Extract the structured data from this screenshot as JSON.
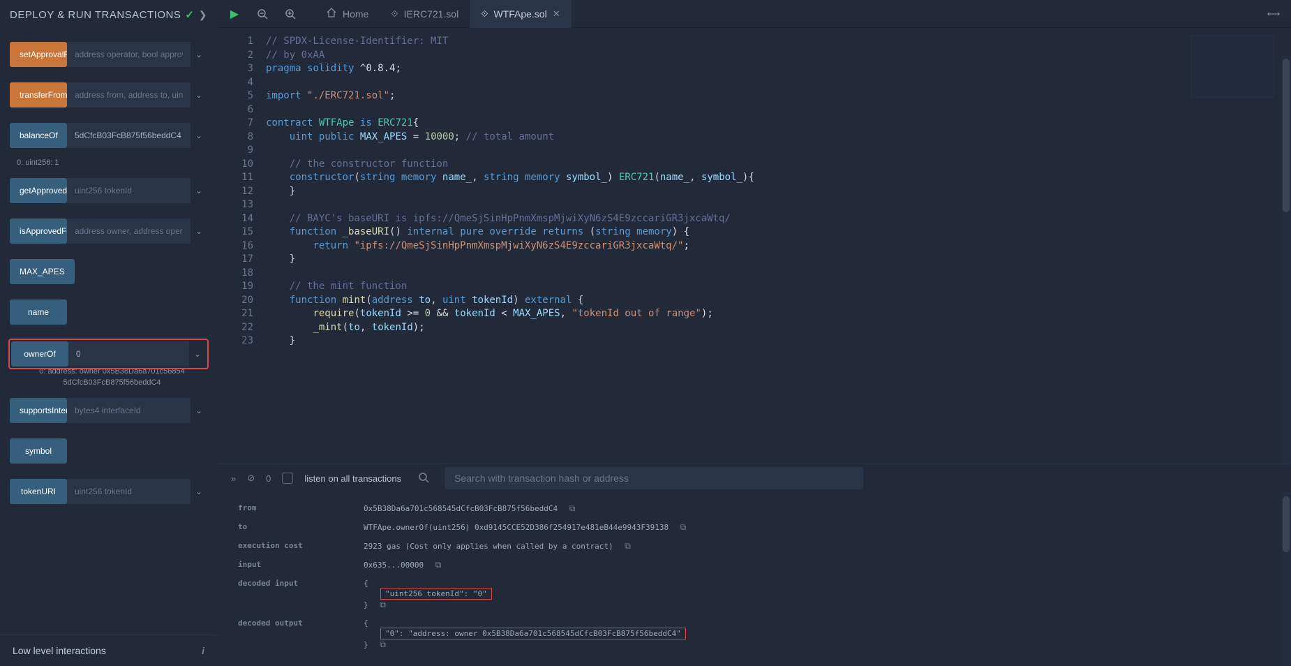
{
  "sidebar": {
    "title": "DEPLOY & RUN TRANSACTIONS",
    "functions": [
      {
        "name": "setApprovalForAll",
        "kind": "orange",
        "placeholder": "address operator, bool approv",
        "input": "",
        "expandable": true
      },
      {
        "name": "transferFrom",
        "kind": "orange",
        "placeholder": "address from, address to, uint",
        "input": "",
        "expandable": true
      },
      {
        "name": "balanceOf",
        "kind": "blue",
        "placeholder": "",
        "input": "5dCfcB03FcB875f56beddC4",
        "expandable": true,
        "output": "0: uint256: 1"
      },
      {
        "name": "getApproved",
        "kind": "blue",
        "placeholder": "uint256 tokenId",
        "input": "",
        "expandable": true
      },
      {
        "name": "isApprovedForAll",
        "kind": "blue",
        "placeholder": "address owner, address opera",
        "input": "",
        "expandable": true
      },
      {
        "name": "MAX_APES",
        "kind": "blue",
        "placeholder": "",
        "input": "",
        "expandable": false,
        "noinput": true
      },
      {
        "name": "name",
        "kind": "blue",
        "placeholder": "",
        "input": "",
        "expandable": false,
        "noinput": true
      },
      {
        "name": "ownerOf",
        "kind": "blue",
        "placeholder": "",
        "input": "0",
        "expandable": true,
        "highlight": true,
        "output_multi": "0: address: owner 0x5B38Da6a701c56854\n5dCfcB03FcB875f56beddC4"
      },
      {
        "name": "supportsInterface",
        "kind": "blue",
        "placeholder": "bytes4 interfaceId",
        "input": "",
        "expandable": true
      },
      {
        "name": "symbol",
        "kind": "blue",
        "placeholder": "",
        "input": "",
        "expandable": false,
        "noinput": true
      },
      {
        "name": "tokenURI",
        "kind": "blue",
        "placeholder": "uint256 tokenId",
        "input": "",
        "expandable": true
      }
    ],
    "lowlevel": "Low level interactions"
  },
  "tabs": [
    {
      "id": "home",
      "label": "Home",
      "icon": "home",
      "active": false,
      "closable": false
    },
    {
      "id": "ierc721",
      "label": "IERC721.sol",
      "icon": "sol",
      "active": false,
      "closable": false
    },
    {
      "id": "wtfape",
      "label": "WTFApe.sol",
      "icon": "sol",
      "active": true,
      "closable": true
    }
  ],
  "code": {
    "lines": [
      {
        "n": 1,
        "html": "<span class='c-comment'>// SPDX-License-Identifier: MIT</span>"
      },
      {
        "n": 2,
        "html": "<span class='c-comment'>// by 0xAA</span>"
      },
      {
        "n": 3,
        "html": "<span class='c-keyword'>pragma</span> <span class='c-keyword'>solidity</span> <span class='c-punct'>^0.8.4;</span>"
      },
      {
        "n": 4,
        "html": ""
      },
      {
        "n": 5,
        "html": "<span class='c-keyword'>import</span> <span class='c-str'>\"./ERC721.sol\"</span><span class='c-punct'>;</span>"
      },
      {
        "n": 6,
        "html": ""
      },
      {
        "n": 7,
        "html": "<span class='c-keyword'>contract</span> <span class='c-type'>WTFApe</span> <span class='c-keyword'>is</span> <span class='c-type'>ERC721</span><span class='c-punct'>{</span>"
      },
      {
        "n": 8,
        "html": "    <span class='c-keyword'>uint</span> <span class='c-keyword'>public</span> <span class='c-ident'>MAX_APES</span> <span class='c-punct'>=</span> <span class='c-num'>10000</span><span class='c-punct'>;</span> <span class='c-comment'>// total amount</span>"
      },
      {
        "n": 9,
        "html": ""
      },
      {
        "n": 10,
        "html": "    <span class='c-comment'>// the constructor function</span>"
      },
      {
        "n": 11,
        "html": "    <span class='c-keyword'>constructor</span><span class='c-punct'>(</span><span class='c-keyword'>string</span> <span class='c-keyword'>memory</span> <span class='c-ident'>name_</span><span class='c-punct'>,</span> <span class='c-keyword'>string</span> <span class='c-keyword'>memory</span> <span class='c-ident'>symbol_</span><span class='c-punct'>)</span> <span class='c-type'>ERC721</span><span class='c-punct'>(</span><span class='c-ident'>name_</span><span class='c-punct'>,</span> <span class='c-ident'>symbol_</span><span class='c-punct'>){</span>"
      },
      {
        "n": 12,
        "html": "    <span class='c-punct'>}</span>"
      },
      {
        "n": 13,
        "html": ""
      },
      {
        "n": 14,
        "html": "    <span class='c-comment'>// BAYC's baseURI is ipfs://QmeSjSinHpPnmXmspMjwiXyN6zS4E9zccariGR3jxcaWtq/</span>"
      },
      {
        "n": 15,
        "html": "    <span class='c-keyword'>function</span> <span class='c-func'>_baseURI</span><span class='c-punct'>()</span> <span class='c-keyword'>internal</span> <span class='c-keyword'>pure</span> <span class='c-keyword'>override</span> <span class='c-keyword'>returns</span> <span class='c-punct'>(</span><span class='c-keyword'>string</span> <span class='c-keyword'>memory</span><span class='c-punct'>) {</span>"
      },
      {
        "n": 16,
        "html": "        <span class='c-keyword'>return</span> <span class='c-str'>\"ipfs://QmeSjSinHpPnmXmspMjwiXyN6zS4E9zccariGR3jxcaWtq/\"</span><span class='c-punct'>;</span>"
      },
      {
        "n": 17,
        "html": "    <span class='c-punct'>}</span>"
      },
      {
        "n": 18,
        "html": ""
      },
      {
        "n": 19,
        "html": "    <span class='c-comment'>// the mint function</span>"
      },
      {
        "n": 20,
        "html": "    <span class='c-keyword'>function</span> <span class='c-func'>mint</span><span class='c-punct'>(</span><span class='c-keyword'>address</span> <span class='c-ident'>to</span><span class='c-punct'>,</span> <span class='c-keyword'>uint</span> <span class='c-ident'>tokenId</span><span class='c-punct'>)</span> <span class='c-keyword'>external</span> <span class='c-punct'>{</span>"
      },
      {
        "n": 21,
        "html": "        <span class='c-func'>require</span><span class='c-punct'>(</span><span class='c-ident'>tokenId</span> <span class='c-punct'>&gt;=</span> <span class='c-num'>0</span> <span class='c-punct'>&amp;&amp;</span> <span class='c-ident'>tokenId</span> <span class='c-punct'>&lt;</span> <span class='c-ident'>MAX_APES</span><span class='c-punct'>,</span> <span class='c-str'>\"tokenId out of range\"</span><span class='c-punct'>);</span>"
      },
      {
        "n": 22,
        "html": "        <span class='c-func'>_mint</span><span class='c-punct'>(</span><span class='c-ident'>to</span><span class='c-punct'>,</span> <span class='c-ident'>tokenId</span><span class='c-punct'>);</span>"
      },
      {
        "n": 23,
        "html": "    <span class='c-punct'>}</span>"
      }
    ]
  },
  "terminal": {
    "listen_label": "listen on all transactions",
    "search_placeholder": "Search with transaction hash or address",
    "count": "0",
    "rows": [
      {
        "key": "from",
        "val": "0x5B38Da6a701c568545dCfcB03FcB875f56beddC4",
        "copy": true
      },
      {
        "key": "to",
        "val": "WTFApe.ownerOf(uint256) 0xd9145CCE52D386f254917e481eB44e9943F39138",
        "copy": true
      },
      {
        "key": "execution cost",
        "val": "2923 gas (Cost only applies when called by a contract)",
        "copy": true
      },
      {
        "key": "input",
        "val": "0x635...00000",
        "copy": true
      }
    ],
    "decoded_input_label": "decoded input",
    "decoded_input_val": "\"uint256 tokenId\": \"0\"",
    "decoded_output_label": "decoded output",
    "decoded_output_val": "\"0\": \"address: owner 0x5B38Da6a701c568545dCfcB03FcB875f56beddC4\""
  }
}
